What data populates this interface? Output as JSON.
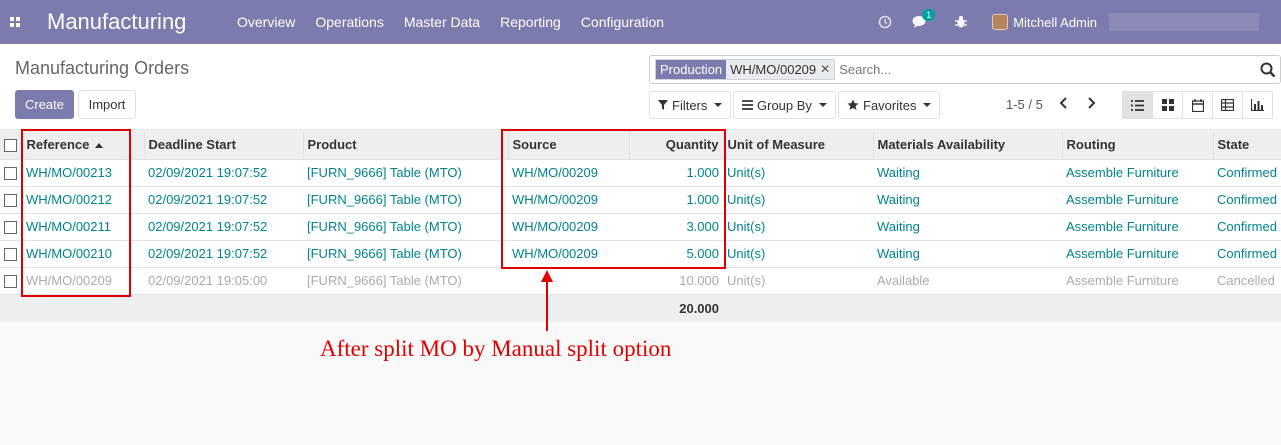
{
  "navbar": {
    "app_name": "Manufacturing",
    "menu": [
      "Overview",
      "Operations",
      "Master Data",
      "Reporting",
      "Configuration"
    ],
    "chat_count": "1",
    "user_name": "Mitchell Admin"
  },
  "control_panel": {
    "title": "Manufacturing Orders",
    "create_label": "Create",
    "import_label": "Import",
    "search": {
      "facet_label": "Production",
      "facet_value": "WH/MO/00209",
      "placeholder": "Search..."
    },
    "filters_label": "Filters",
    "group_by_label": "Group By",
    "favorites_label": "Favorites",
    "pager": "1-5 / 5"
  },
  "table": {
    "columns": [
      "Reference",
      "Deadline Start",
      "Product",
      "Source",
      "Quantity",
      "Unit of Measure",
      "Materials Availability",
      "Routing",
      "State"
    ],
    "rows": [
      [
        "WH/MO/00213",
        "02/09/2021 19:07:52",
        "[FURN_9666] Table (MTO)",
        "WH/MO/00209",
        "1.000",
        "Unit(s)",
        "Waiting",
        "Assemble Furniture",
        "Confirmed"
      ],
      [
        "WH/MO/00212",
        "02/09/2021 19:07:52",
        "[FURN_9666] Table (MTO)",
        "WH/MO/00209",
        "1.000",
        "Unit(s)",
        "Waiting",
        "Assemble Furniture",
        "Confirmed"
      ],
      [
        "WH/MO/00211",
        "02/09/2021 19:07:52",
        "[FURN_9666] Table (MTO)",
        "WH/MO/00209",
        "3.000",
        "Unit(s)",
        "Waiting",
        "Assemble Furniture",
        "Confirmed"
      ],
      [
        "WH/MO/00210",
        "02/09/2021 19:07:52",
        "[FURN_9666] Table (MTO)",
        "WH/MO/00209",
        "5.000",
        "Unit(s)",
        "Waiting",
        "Assemble Furniture",
        "Confirmed"
      ],
      [
        "WH/MO/00209",
        "02/09/2021 19:05:00",
        "[FURN_9666] Table (MTO)",
        "",
        "10.000",
        "Unit(s)",
        "Available",
        "Assemble Furniture",
        "Cancelled"
      ]
    ],
    "total_quantity": "20.000"
  },
  "annotation": {
    "text": "After split MO by Manual split option",
    "color": "#e00000"
  }
}
